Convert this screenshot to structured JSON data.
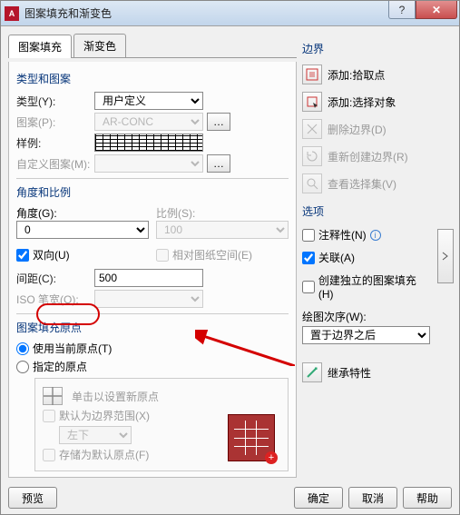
{
  "title": "图案填充和渐变色",
  "tabs": {
    "fill": "图案填充",
    "grad": "渐变色"
  },
  "type_group": "类型和图案",
  "type_lbl": "类型(Y):",
  "type_val": "用户定义",
  "pattern_lbl": "图案(P):",
  "pattern_val": "AR-CONC",
  "sample_lbl": "样例:",
  "custom_lbl": "自定义图案(M):",
  "angle_group": "角度和比例",
  "angle_lbl": "角度(G):",
  "angle_val": "0",
  "scale_lbl": "比例(S):",
  "scale_val": "100",
  "bidir": "双向(U)",
  "paperspace": "相对图纸空间(E)",
  "spacing_lbl": "间距(C):",
  "spacing_val": "500",
  "iso_lbl": "ISO 笔宽(O):",
  "origin_group": "图案填充原点",
  "use_current": "使用当前原点(T)",
  "specified": "指定的原点",
  "click_set": "单击以设置新原点",
  "default_ext": "默认为边界范围(X)",
  "pos_val": "左下",
  "store_default": "存储为默认原点(F)",
  "boundary": "边界",
  "add_pick": "添加:拾取点",
  "add_select": "添加:选择对象",
  "del_boundary": "删除边界(D)",
  "recreate": "重新创建边界(R)",
  "view_sel": "查看选择集(V)",
  "options": "选项",
  "annotative": "注释性(N)",
  "associative": "关联(A)",
  "independent": "创建独立的图案填充(H)",
  "draw_order": "绘图次序(W):",
  "draw_order_val": "置于边界之后",
  "inherit": "继承特性",
  "preview": "预览",
  "ok": "确定",
  "cancel": "取消",
  "help": "帮助"
}
